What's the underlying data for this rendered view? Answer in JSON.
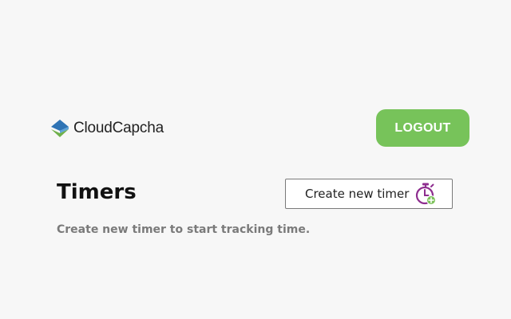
{
  "header": {
    "logo_text": "CloudCapcha",
    "logout_label": "LOGOUT"
  },
  "main": {
    "title": "Timers",
    "create_label": "Create new timer",
    "empty_message": "Create new timer to start tracking time."
  },
  "icons": {
    "logo": "cloudcapcha-logo-icon",
    "create": "stopwatch-plus-icon"
  },
  "colors": {
    "accent": "#77c35a",
    "logo_blue": "#2f74b5",
    "logo_green": "#6fb04a",
    "timer_purple": "#8e2e8f",
    "timer_green": "#7cc25a"
  }
}
